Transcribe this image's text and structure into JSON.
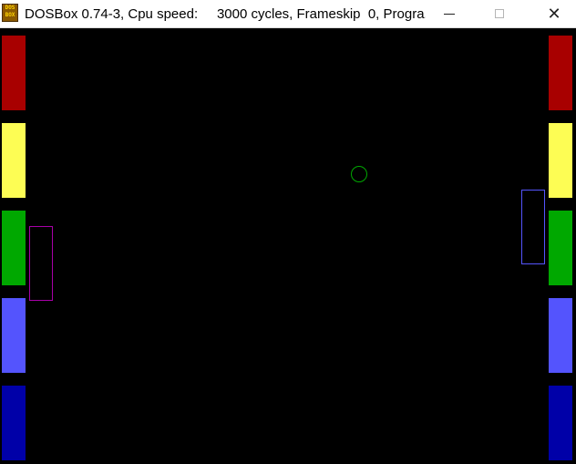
{
  "window": {
    "title": "DOSBox 0.74-3, Cpu speed:     3000 cycles, Frameskip  0, Progra...",
    "icon": "dosbox-icon",
    "icon_text_line1": "DOS",
    "icon_text_line2": "BOX",
    "buttons": [
      {
        "name": "minimize",
        "icon": "minimize-icon"
      },
      {
        "name": "maximize",
        "icon": "maximize-icon"
      },
      {
        "name": "close",
        "icon": "close-icon",
        "glyph": "✕"
      }
    ]
  },
  "colors": {
    "background": "#000000",
    "red": "#a80000",
    "yellow": "#fdfd54",
    "green": "#00a800",
    "light_blue": "#5454fd",
    "dark_blue": "#0000a8",
    "left_paddle_outline": "#a800a8",
    "right_paddle_outline": "#5454fd",
    "ball_outline": "#00a800"
  },
  "game": {
    "left_bars": [
      "red",
      "yellow",
      "green",
      "light_blue",
      "dark_blue"
    ],
    "right_bars": [
      "red",
      "yellow",
      "green",
      "light_blue",
      "dark_blue"
    ]
  }
}
